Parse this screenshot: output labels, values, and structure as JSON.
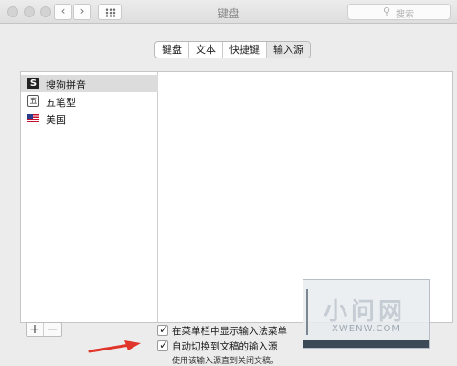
{
  "window": {
    "title": "键盘",
    "search_placeholder": "搜索"
  },
  "tabs": [
    {
      "label": "键盘",
      "active": false
    },
    {
      "label": "文本",
      "active": false
    },
    {
      "label": "快捷键",
      "active": false
    },
    {
      "label": "输入源",
      "active": true
    }
  ],
  "input_sources": [
    {
      "label": "搜狗拼音",
      "icon": "sogou-s-icon",
      "selected": true
    },
    {
      "label": "五笔型",
      "icon": "wubi-icon",
      "selected": false
    },
    {
      "label": "美国",
      "icon": "us-flag-icon",
      "selected": false
    }
  ],
  "list_controls": {
    "add": "+",
    "remove": "−"
  },
  "options": {
    "show_menu": {
      "label": "在菜单栏中显示输入法菜单",
      "checked": true
    },
    "auto_switch": {
      "label": "自动切换到文稿的输入源",
      "checked": true
    },
    "hint": "使用该输入源直到关闭文稿。"
  },
  "watermark": {
    "logo": "小问网",
    "url": "XWENW.COM"
  },
  "colors": {
    "arrow": "#e0352b",
    "selection": "#dcdcdc"
  }
}
